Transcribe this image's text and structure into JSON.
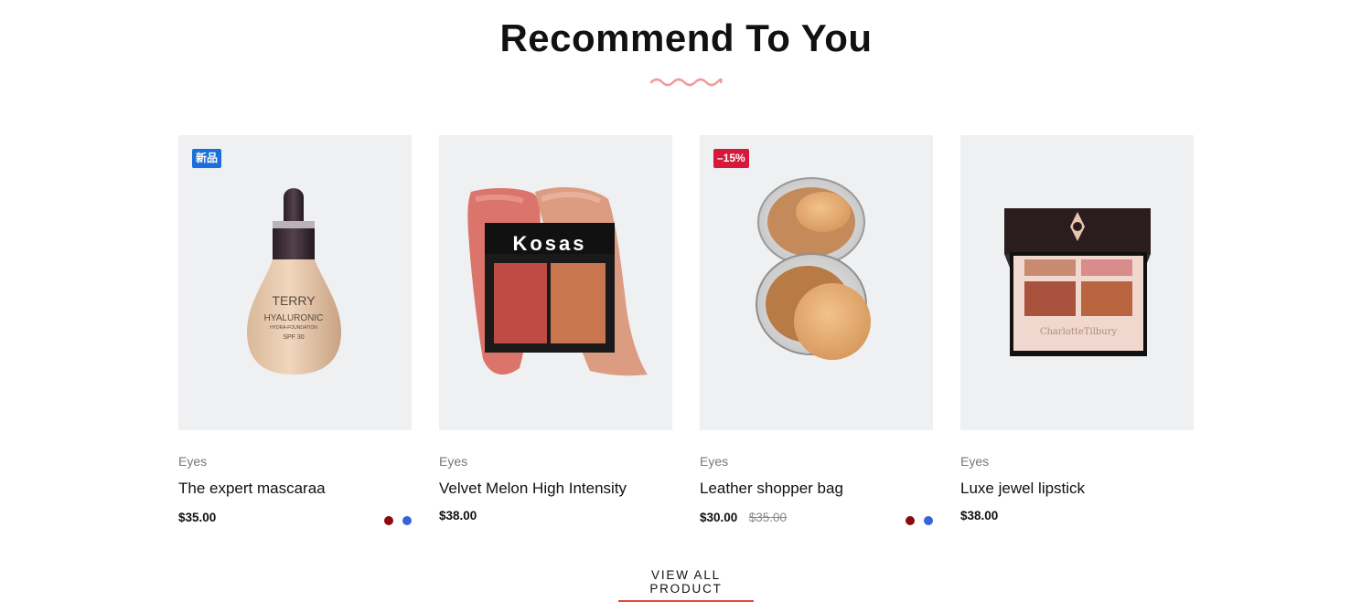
{
  "section": {
    "title": "Recommend To You"
  },
  "colors": {
    "accent": "#e5473a",
    "wave": "#f09a9a",
    "thumb_bg": "#eff0f2",
    "badge_new": "#1a6fd8",
    "badge_sale": "#d6193a"
  },
  "products": [
    {
      "category": "Eyes",
      "name": "The expert mascaraa",
      "price": "$35.00",
      "old_price": "",
      "badge": "新品",
      "image": "foundation-bottle",
      "brand_text": [
        "TERRY",
        "HYALURONIC",
        "HYDRA-FOUNDATION",
        "SPF 30"
      ],
      "swatches": [
        "#8b0a0a",
        "#3a63d8"
      ]
    },
    {
      "category": "Eyes",
      "name": "Velvet Melon High Intensity",
      "price": "$38.00",
      "old_price": "",
      "badge": "",
      "image": "blush-duo",
      "brand_text": [
        "Kosas"
      ],
      "swatches": []
    },
    {
      "category": "Eyes",
      "name": "Leather shopper bag",
      "price": "$30.00",
      "old_price": "$35.00",
      "badge": "–15%",
      "image": "powder-compact",
      "brand_text": [],
      "swatches": [
        "#8b0a0a",
        "#3a63d8"
      ]
    },
    {
      "category": "Eyes",
      "name": "Luxe jewel lipstick",
      "price": "$38.00",
      "old_price": "",
      "badge": "",
      "image": "eyeshadow-palette",
      "brand_text": [
        "CharlotteTilbury"
      ],
      "swatches": []
    }
  ],
  "view_all": {
    "label": "VIEW ALL PRODUCT"
  }
}
